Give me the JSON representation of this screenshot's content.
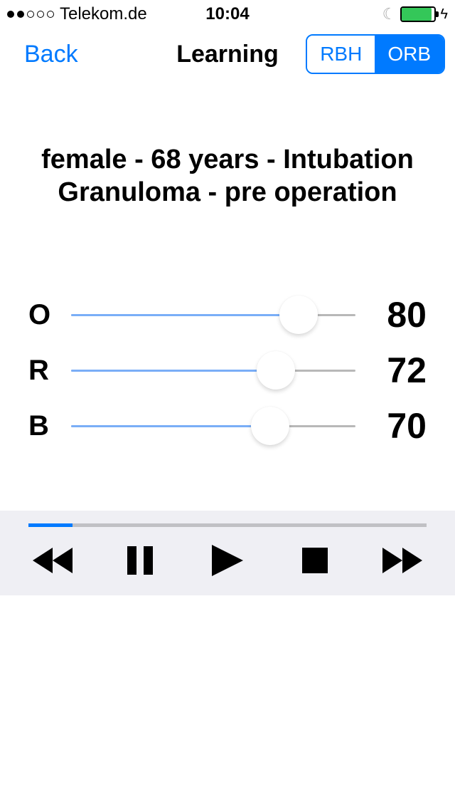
{
  "status": {
    "carrier": "Telekom.de",
    "time": "10:04"
  },
  "nav": {
    "back": "Back",
    "title": "Learning",
    "segments": {
      "rbh": "RBH",
      "orb": "ORB",
      "active": "orb"
    }
  },
  "case": {
    "title": "female - 68 years - Intubation Granuloma - pre operation"
  },
  "sliders": {
    "o": {
      "label": "O",
      "value": 80
    },
    "r": {
      "label": "R",
      "value": 72
    },
    "b": {
      "label": "B",
      "value": 70
    }
  },
  "player": {
    "progress_percent": 11
  }
}
